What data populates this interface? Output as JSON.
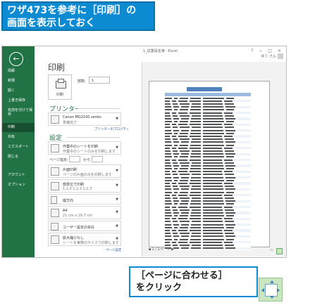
{
  "callout_top": {
    "line1": "ワザ473を参考に［印刷］の",
    "line2": "画面を表示しておく"
  },
  "callout_bottom": {
    "line1": "［ページに合わせる］",
    "line2": "をクリック"
  },
  "window": {
    "title": "1_従業員名簿 - Excel",
    "controls": "? − □ ×",
    "user": "ゆう さん"
  },
  "sidebar": {
    "back": "←",
    "items": [
      {
        "label": "情報"
      },
      {
        "label": "新規"
      },
      {
        "label": "開く"
      },
      {
        "label": "上書き保存"
      },
      {
        "label": "名前を付けて保存"
      },
      {
        "label": "印刷"
      },
      {
        "label": "共有"
      },
      {
        "label": "エクスポート"
      },
      {
        "label": "閉じる"
      },
      {
        "label": "アカウント"
      },
      {
        "label": "オプション"
      }
    ]
  },
  "print": {
    "heading": "印刷",
    "button_label": "印刷",
    "copies_label": "部数:",
    "copies_value": "1"
  },
  "printer": {
    "section": "プリンター",
    "name": "Canon MG2100 series",
    "status": "準備完了",
    "properties_link": "プリンターのプロパティ"
  },
  "settings": {
    "section": "設定",
    "items": [
      {
        "t1": "作業中のシートを印刷",
        "t2": "作業中のシートのみを印刷します"
      },
      {
        "t1": "片面印刷",
        "t2": "ページの片面のみを印刷します"
      },
      {
        "t1": "部単位で印刷",
        "t2": "1,2,3   1,2,3   1,2,3"
      },
      {
        "t1": "縦方向",
        "t2": ""
      },
      {
        "t1": "A4",
        "t2": "21 cm x 29.7 cm"
      },
      {
        "t1": "ユーザー設定の余白",
        "t2": ""
      },
      {
        "t1": "拡大縮小なし",
        "t2": "シートを実際のサイズで印刷します"
      }
    ],
    "pages_label": "ページ指定:",
    "pages_to": "から",
    "page_setup_link": "ページ設定"
  },
  "preview": {
    "page_current": "1",
    "page_total": "/ 1ページ"
  }
}
